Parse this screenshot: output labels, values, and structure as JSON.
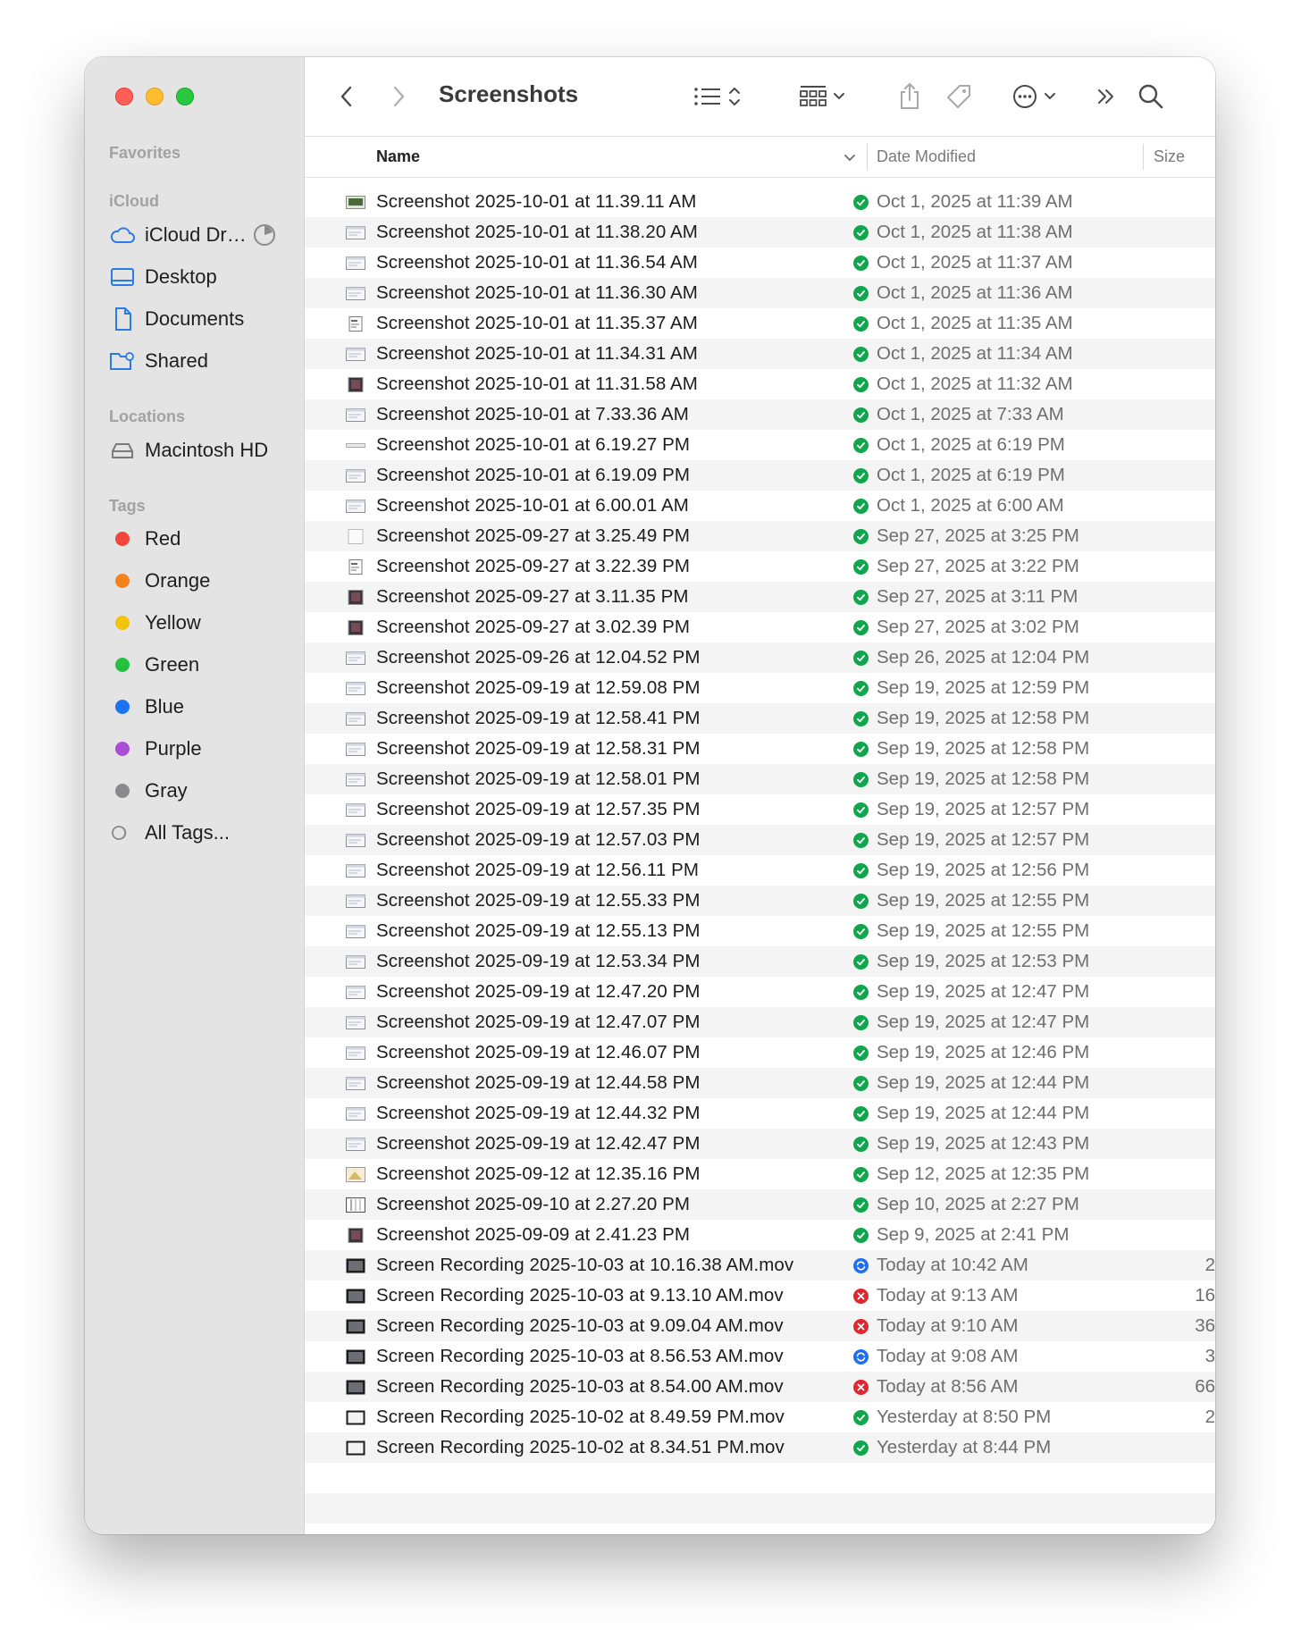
{
  "window": {
    "title": "Screenshots"
  },
  "sidebar": {
    "favorites_header": "Favorites",
    "icloud_header": "iCloud",
    "icloud_items": [
      {
        "label": "iCloud Dr…",
        "icon": "cloud-icon"
      },
      {
        "label": "Desktop",
        "icon": "desktop-icon"
      },
      {
        "label": "Documents",
        "icon": "document-icon"
      },
      {
        "label": "Shared",
        "icon": "shared-folder-icon"
      }
    ],
    "locations_header": "Locations",
    "location_items": [
      {
        "label": "Macintosh HD",
        "icon": "disk-icon"
      }
    ],
    "tags_header": "Tags",
    "tags": [
      {
        "label": "Red",
        "color": "#f2453b"
      },
      {
        "label": "Orange",
        "color": "#f5821f"
      },
      {
        "label": "Yellow",
        "color": "#f3c20b"
      },
      {
        "label": "Green",
        "color": "#26c03f"
      },
      {
        "label": "Blue",
        "color": "#1a74ef"
      },
      {
        "label": "Purple",
        "color": "#a94fd6"
      },
      {
        "label": "Gray",
        "color": "#8a8a8e"
      }
    ],
    "all_tags": "All Tags..."
  },
  "columns": {
    "name": "Name",
    "date": "Date Modified",
    "size": "Size"
  },
  "files": [
    {
      "name": "Screenshot 2025-10-01 at 11.39.11 AM",
      "date": "Oct 1, 2025 at 11:39 AM",
      "size": "",
      "status": "ok",
      "thumb": "photo"
    },
    {
      "name": "Screenshot 2025-10-01 at 11.38.20 AM",
      "date": "Oct 1, 2025 at 11:38 AM",
      "size": "",
      "status": "ok",
      "thumb": "ui"
    },
    {
      "name": "Screenshot 2025-10-01 at 11.36.54 AM",
      "date": "Oct 1, 2025 at 11:37 AM",
      "size": "",
      "status": "ok",
      "thumb": "ui"
    },
    {
      "name": "Screenshot 2025-10-01 at 11.36.30 AM",
      "date": "Oct 1, 2025 at 11:36 AM",
      "size": "",
      "status": "ok",
      "thumb": "ui"
    },
    {
      "name": "Screenshot 2025-10-01 at 11.35.37 AM",
      "date": "Oct 1, 2025 at 11:35 AM",
      "size": "",
      "status": "ok",
      "thumb": "doc"
    },
    {
      "name": "Screenshot 2025-10-01 at 11.34.31 AM",
      "date": "Oct 1, 2025 at 11:34 AM",
      "size": "",
      "status": "ok",
      "thumb": "ui"
    },
    {
      "name": "Screenshot 2025-10-01 at 11.31.58 AM",
      "date": "Oct 1, 2025 at 11:32 AM",
      "size": "",
      "status": "ok",
      "thumb": "dark"
    },
    {
      "name": "Screenshot 2025-10-01 at 7.33.36 AM",
      "date": "Oct 1, 2025 at 7:33 AM",
      "size": "",
      "status": "ok",
      "thumb": "ui"
    },
    {
      "name": "Screenshot 2025-10-01 at 6.19.27 PM",
      "date": "Oct 1, 2025 at 6:19 PM",
      "size": "",
      "status": "ok",
      "thumb": "line"
    },
    {
      "name": "Screenshot 2025-10-01 at 6.19.09 PM",
      "date": "Oct 1, 2025 at 6:19 PM",
      "size": "",
      "status": "ok",
      "thumb": "ui"
    },
    {
      "name": "Screenshot 2025-10-01 at 6.00.01 AM",
      "date": "Oct 1, 2025 at 6:00 AM",
      "size": "",
      "status": "ok",
      "thumb": "ui"
    },
    {
      "name": "Screenshot 2025-09-27 at 3.25.49 PM",
      "date": "Sep 27, 2025 at 3:25 PM",
      "size": "",
      "status": "ok",
      "thumb": "blank"
    },
    {
      "name": "Screenshot 2025-09-27 at 3.22.39 PM",
      "date": "Sep 27, 2025 at 3:22 PM",
      "size": "",
      "status": "ok",
      "thumb": "doc"
    },
    {
      "name": "Screenshot 2025-09-27 at 3.11.35 PM",
      "date": "Sep 27, 2025 at 3:11 PM",
      "size": "",
      "status": "ok",
      "thumb": "dark"
    },
    {
      "name": "Screenshot 2025-09-27 at 3.02.39 PM",
      "date": "Sep 27, 2025 at 3:02 PM",
      "size": "",
      "status": "ok",
      "thumb": "dark"
    },
    {
      "name": "Screenshot 2025-09-26 at 12.04.52 PM",
      "date": "Sep 26, 2025 at 12:04 PM",
      "size": "",
      "status": "ok",
      "thumb": "ui"
    },
    {
      "name": "Screenshot 2025-09-19 at 12.59.08 PM",
      "date": "Sep 19, 2025 at 12:59 PM",
      "size": "",
      "status": "ok",
      "thumb": "ui"
    },
    {
      "name": "Screenshot 2025-09-19 at 12.58.41 PM",
      "date": "Sep 19, 2025 at 12:58 PM",
      "size": "",
      "status": "ok",
      "thumb": "ui"
    },
    {
      "name": "Screenshot 2025-09-19 at 12.58.31 PM",
      "date": "Sep 19, 2025 at 12:58 PM",
      "size": "",
      "status": "ok",
      "thumb": "ui"
    },
    {
      "name": "Screenshot 2025-09-19 at 12.58.01 PM",
      "date": "Sep 19, 2025 at 12:58 PM",
      "size": "",
      "status": "ok",
      "thumb": "ui"
    },
    {
      "name": "Screenshot 2025-09-19 at 12.57.35 PM",
      "date": "Sep 19, 2025 at 12:57 PM",
      "size": "",
      "status": "ok",
      "thumb": "ui"
    },
    {
      "name": "Screenshot 2025-09-19 at 12.57.03 PM",
      "date": "Sep 19, 2025 at 12:57 PM",
      "size": "",
      "status": "ok",
      "thumb": "ui"
    },
    {
      "name": "Screenshot 2025-09-19 at 12.56.11 PM",
      "date": "Sep 19, 2025 at 12:56 PM",
      "size": "",
      "status": "ok",
      "thumb": "ui"
    },
    {
      "name": "Screenshot 2025-09-19 at 12.55.33 PM",
      "date": "Sep 19, 2025 at 12:55 PM",
      "size": "",
      "status": "ok",
      "thumb": "ui"
    },
    {
      "name": "Screenshot 2025-09-19 at 12.55.13 PM",
      "date": "Sep 19, 2025 at 12:55 PM",
      "size": "",
      "status": "ok",
      "thumb": "ui"
    },
    {
      "name": "Screenshot 2025-09-19 at 12.53.34 PM",
      "date": "Sep 19, 2025 at 12:53 PM",
      "size": "",
      "status": "ok",
      "thumb": "ui"
    },
    {
      "name": "Screenshot 2025-09-19 at 12.47.20 PM",
      "date": "Sep 19, 2025 at 12:47 PM",
      "size": "",
      "status": "ok",
      "thumb": "ui"
    },
    {
      "name": "Screenshot 2025-09-19 at 12.47.07 PM",
      "date": "Sep 19, 2025 at 12:47 PM",
      "size": "",
      "status": "ok",
      "thumb": "ui"
    },
    {
      "name": "Screenshot 2025-09-19 at 12.46.07 PM",
      "date": "Sep 19, 2025 at 12:46 PM",
      "size": "",
      "status": "ok",
      "thumb": "ui"
    },
    {
      "name": "Screenshot 2025-09-19 at 12.44.58 PM",
      "date": "Sep 19, 2025 at 12:44 PM",
      "size": "",
      "status": "ok",
      "thumb": "ui"
    },
    {
      "name": "Screenshot 2025-09-19 at 12.44.32 PM",
      "date": "Sep 19, 2025 at 12:44 PM",
      "size": "",
      "status": "ok",
      "thumb": "ui"
    },
    {
      "name": "Screenshot 2025-09-19 at 12.42.47 PM",
      "date": "Sep 19, 2025 at 12:43 PM",
      "size": "",
      "status": "ok",
      "thumb": "ui"
    },
    {
      "name": "Screenshot 2025-09-12 at 12.35.16 PM",
      "date": "Sep 12, 2025 at 12:35 PM",
      "size": "",
      "status": "ok",
      "thumb": "photo-light"
    },
    {
      "name": "Screenshot 2025-09-10 at 2.27.20 PM",
      "date": "Sep 10, 2025 at 2:27 PM",
      "size": "",
      "status": "ok",
      "thumb": "grid"
    },
    {
      "name": "Screenshot 2025-09-09 at 2.41.23 PM",
      "date": "Sep 9, 2025 at 2:41 PM",
      "size": "",
      "status": "ok",
      "thumb": "dark"
    },
    {
      "name": "Screen Recording 2025-10-03 at 10.16.38 AM.mov",
      "date": "Today at 10:42 AM",
      "size": "2",
      "status": "sync",
      "thumb": "video"
    },
    {
      "name": "Screen Recording 2025-10-03 at 9.13.10 AM.mov",
      "date": "Today at 9:13 AM",
      "size": "16",
      "status": "error",
      "thumb": "video"
    },
    {
      "name": "Screen Recording 2025-10-03 at 9.09.04 AM.mov",
      "date": "Today at 9:10 AM",
      "size": "36",
      "status": "error",
      "thumb": "video"
    },
    {
      "name": "Screen Recording 2025-10-03 at 8.56.53 AM.mov",
      "date": "Today at 9:08 AM",
      "size": "3",
      "status": "sync",
      "thumb": "video"
    },
    {
      "name": "Screen Recording 2025-10-03 at 8.54.00 AM.mov",
      "date": "Today at 8:56 AM",
      "size": "66",
      "status": "error",
      "thumb": "video"
    },
    {
      "name": "Screen Recording 2025-10-02 at 8.49.59 PM.mov",
      "date": "Yesterday at 8:50 PM",
      "size": "2",
      "status": "ok",
      "thumb": "video-light"
    },
    {
      "name": "Screen Recording 2025-10-02 at 8.34.51 PM.mov",
      "date": "Yesterday at 8:44 PM",
      "size": "",
      "status": "ok",
      "thumb": "video-light"
    }
  ]
}
